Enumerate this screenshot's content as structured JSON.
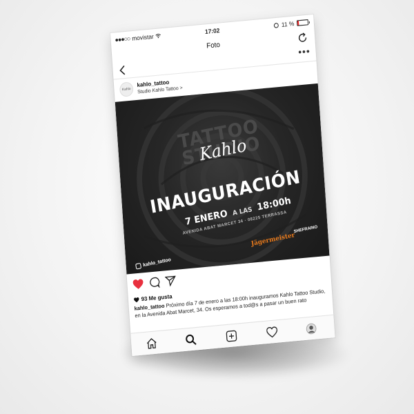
{
  "status_bar": {
    "carrier": "movistar",
    "signal": "●●●○○",
    "time": "17:02",
    "battery": "11 %"
  },
  "header": {
    "title": "Foto"
  },
  "post": {
    "username": "kahlo_tattoo",
    "location": "Studio Kahlo Tattoo",
    "location_chevron": ">",
    "more": "•••",
    "avatar_text": "Kahlo",
    "image": {
      "bg_text": "TATTOO STUDIO",
      "brand": "Kahlo",
      "headline": "INAUGURACIÓN",
      "date_main": "7 ENERO",
      "date_connector": "A LAS",
      "date_time": "18:00h",
      "address": "AVENIDA ABAT MARCET 34 · 08225 TERRASSA",
      "sponsor_1": "Jägermeister",
      "sponsor_2": "SHEFRAINO",
      "handle": "kahlo_tattoo"
    },
    "likes": "93 Me gusta",
    "caption_user": "kahlo_tattoo",
    "caption_text": "Próximo día 7 de enero a las 18:00h inauguramos Kahlo Tattoo Studio, en la Avenida Abat Marcet, 34. Os esperamos a tod@s a pasar un buen rato"
  },
  "colors": {
    "heart": "#e8303e",
    "sponsor": "#e87a1c",
    "poster_bg": "#262626"
  },
  "icons": {
    "status": [
      "wifi-icon",
      "alarm-icon",
      "battery-icon"
    ],
    "header": [
      "back-icon",
      "refresh-icon",
      "more-icon"
    ],
    "actions": [
      "heart-icon",
      "comment-icon",
      "share-icon",
      "bookmark-icon"
    ],
    "nav": [
      "home-icon",
      "search-icon",
      "add-icon",
      "activity-icon",
      "profile-icon"
    ]
  }
}
